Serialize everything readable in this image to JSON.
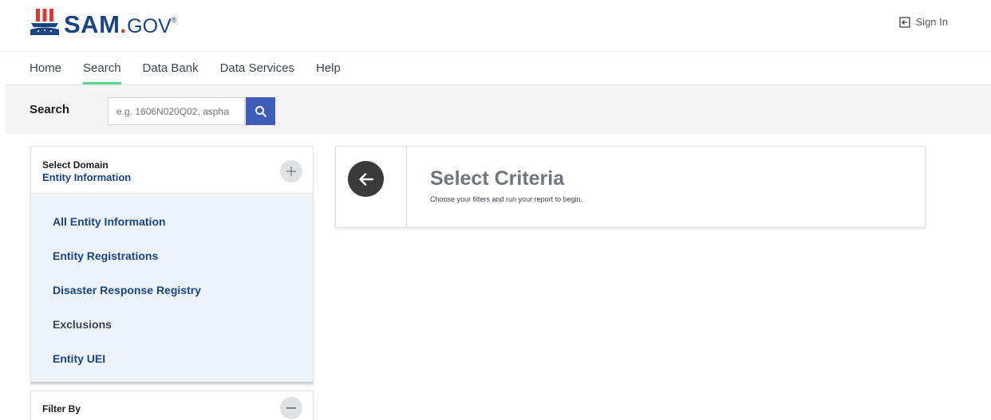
{
  "header": {
    "logo": {
      "sam": "SAM",
      "dot": ".",
      "gov": "GOV",
      "reg": "®"
    },
    "sign_in": {
      "label": "Sign In",
      "icon": "sign-in-icon"
    }
  },
  "nav": {
    "items": [
      {
        "label": "Home",
        "active": false
      },
      {
        "label": "Search",
        "active": true
      },
      {
        "label": "Data Bank",
        "active": false
      },
      {
        "label": "Data Services",
        "active": false
      },
      {
        "label": "Help",
        "active": false
      }
    ]
  },
  "search": {
    "label": "Search",
    "placeholder": "e.g. 1606N020Q02, aspha",
    "button_icon": "search-icon"
  },
  "domain": {
    "title": "Select Domain",
    "value": "Entity Information",
    "toggle_icon": "plus-icon",
    "items": [
      {
        "label": "All Entity Information"
      },
      {
        "label": "Entity Registrations"
      },
      {
        "label": "Disaster Response Registry"
      },
      {
        "label": "Exclusions"
      },
      {
        "label": "Entity UEI"
      }
    ]
  },
  "filter": {
    "title": "Filter By",
    "toggle_icon": "minus-icon"
  },
  "criteria": {
    "title": "Select Criteria",
    "subtitle": "Choose your filters and run your report to begin.",
    "back_icon": "arrow-left-icon"
  },
  "colors": {
    "brand_blue": "#1a4480",
    "brand_red": "#d83933",
    "active_tab_underline": "#5ed885",
    "search_button": "#3e5bb7",
    "domain_list_bg": "#eef2f9"
  }
}
